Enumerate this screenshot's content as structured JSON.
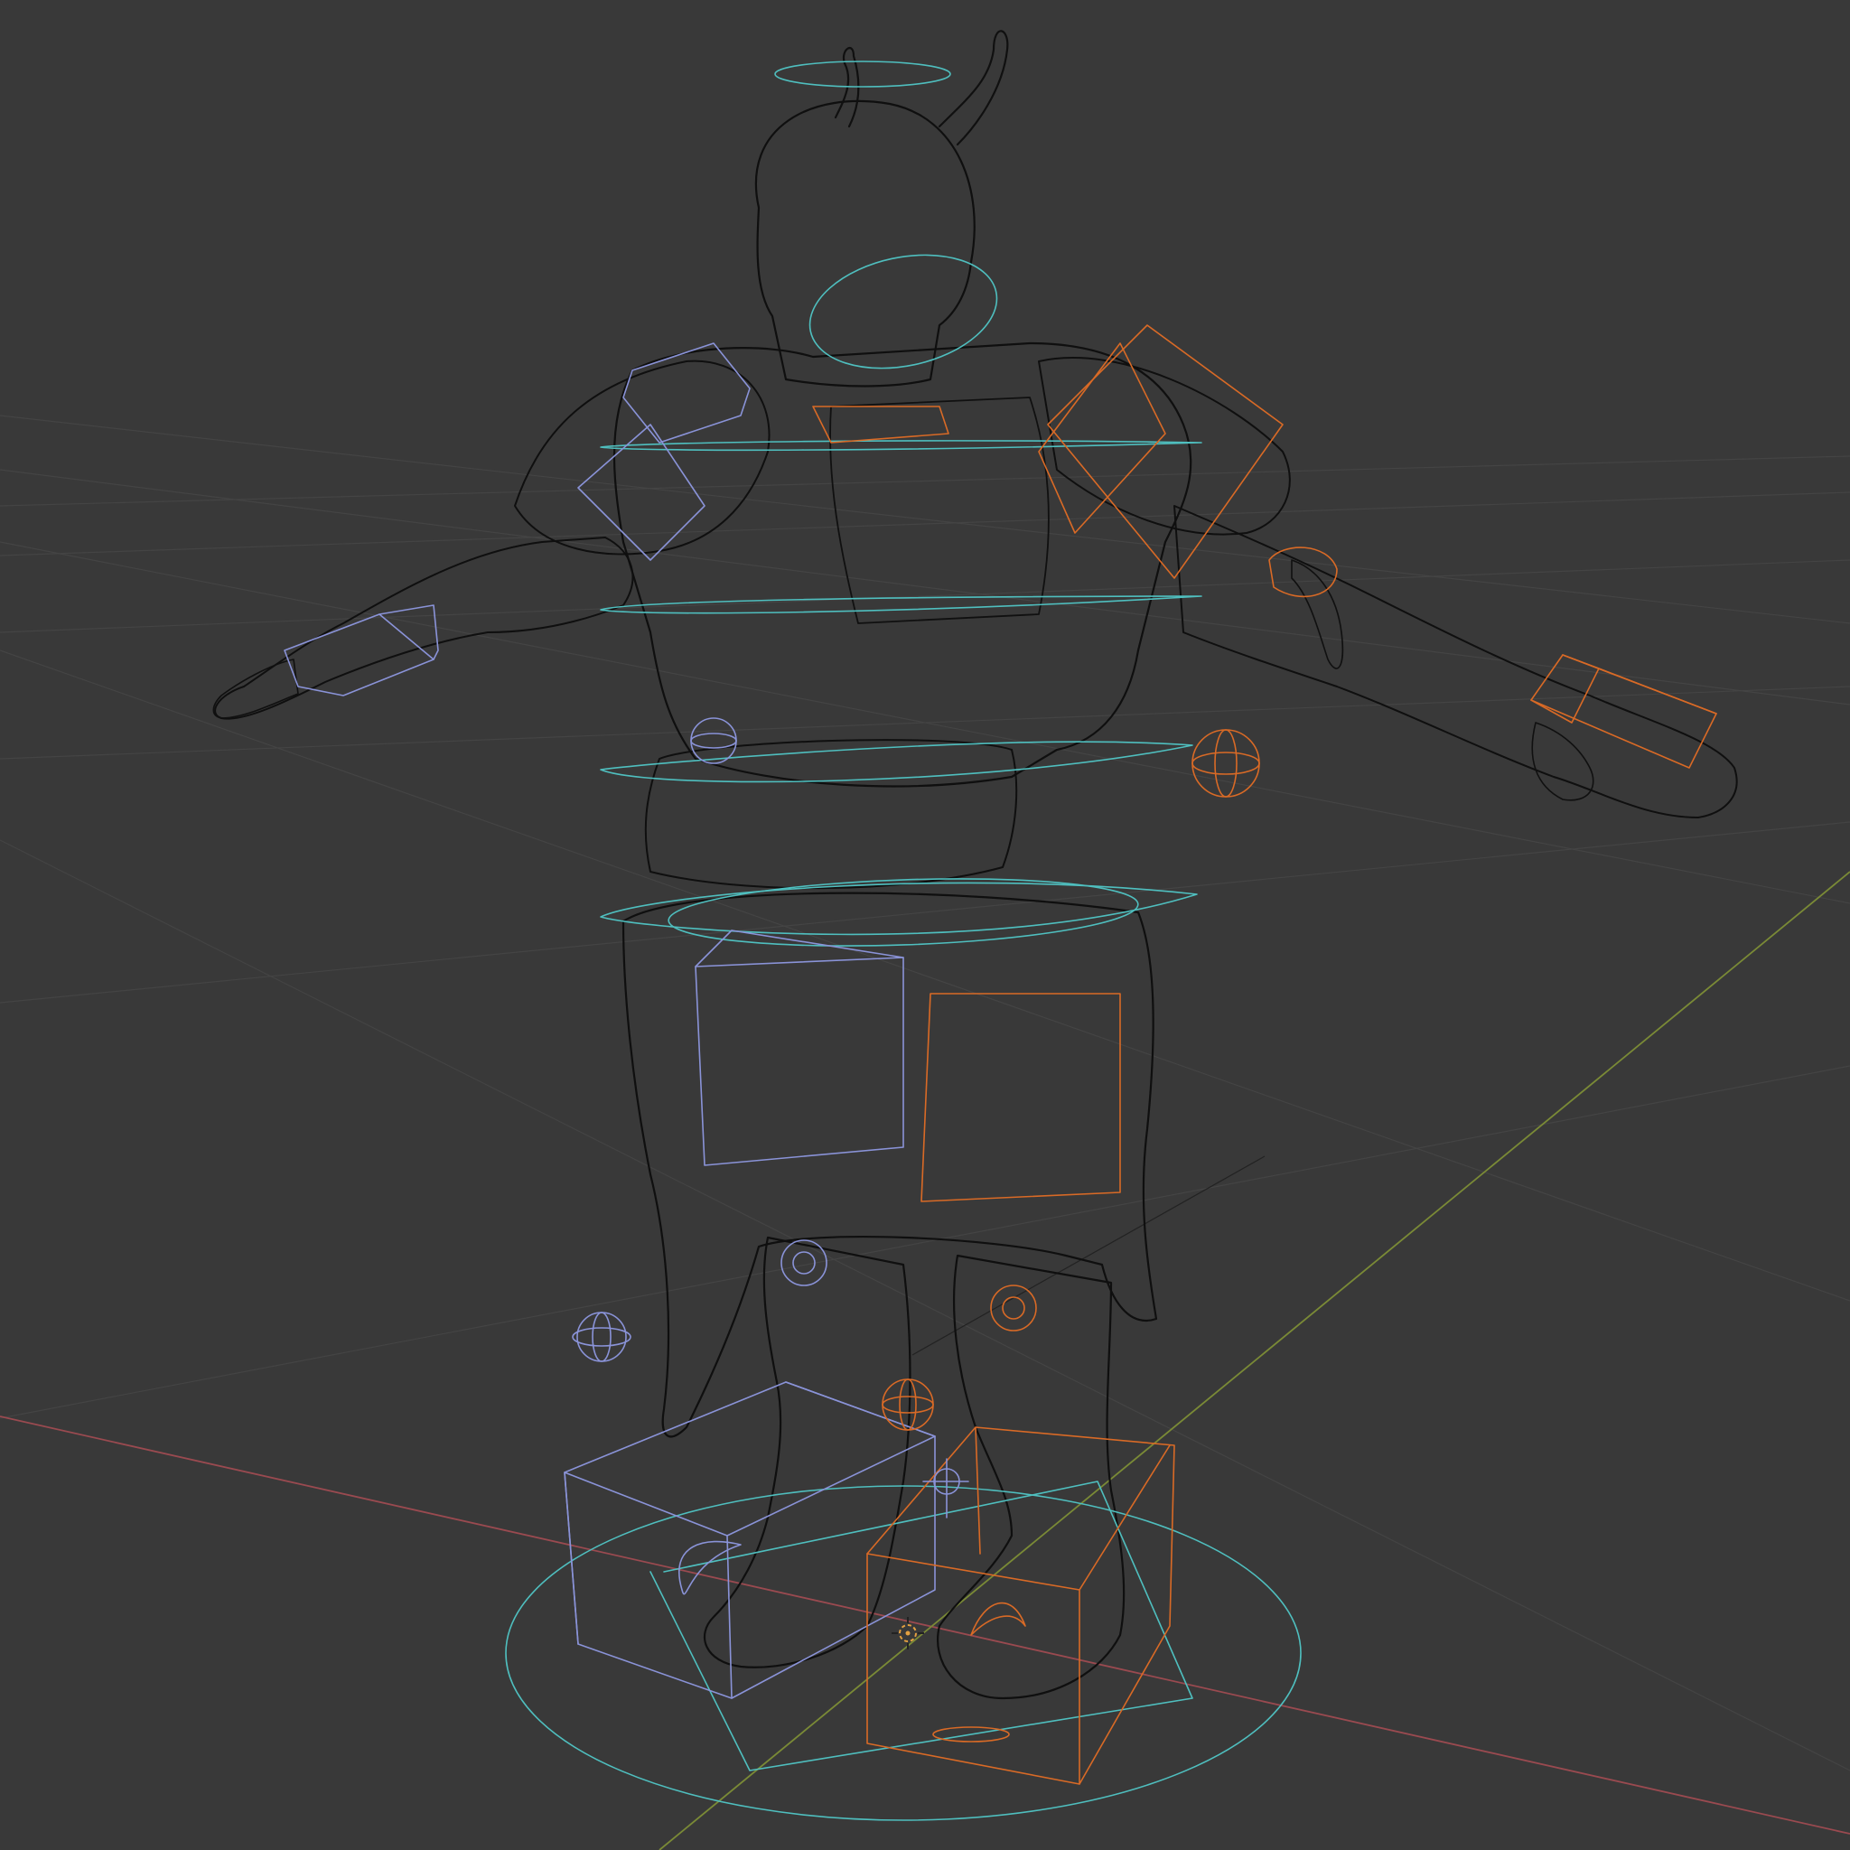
{
  "viewport": {
    "name": "3D Viewport",
    "shading_mode": "wireframe",
    "model": "armored-character-t-pose",
    "has_armature_controls": true,
    "colors": {
      "background": "#393939",
      "grid": "#444444",
      "x_axis": "#9a4a50",
      "y_axis": "#7a8a36",
      "mesh_wire": "#141414",
      "control_cyan": "#4fbfbf",
      "control_blue": "#8a93d8",
      "control_orange": "#d96a26",
      "origin_marker": "#e3a040"
    },
    "icons": {
      "origin": "3d-cursor-icon"
    }
  }
}
